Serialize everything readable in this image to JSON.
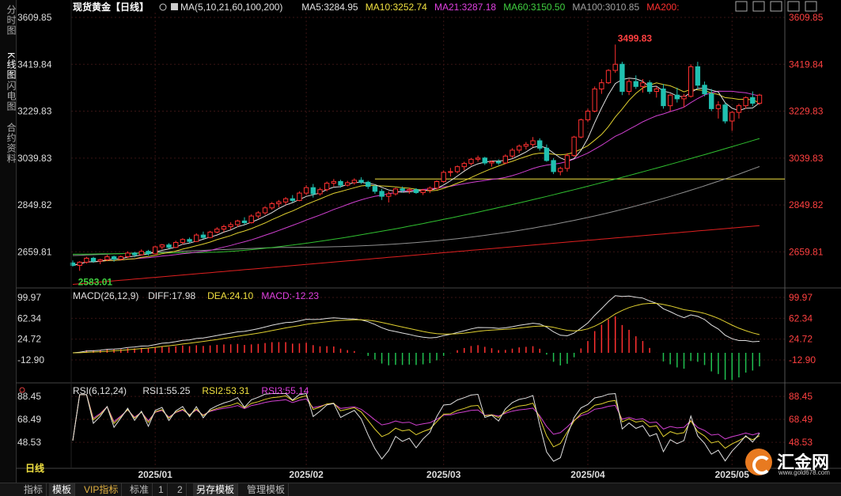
{
  "sidebar": {
    "tabs": [
      "分时图",
      "K线图",
      "闪电图",
      "合约资料"
    ]
  },
  "header": {
    "title": "现货黄金【日线】",
    "ma_items": [
      {
        "text": "MA(5,10,21,60,100,200)",
        "color": "#e0e0e0"
      },
      {
        "text": "MA5:3284.95",
        "color": "#e0e0e0"
      },
      {
        "text": "MA10:3252.74",
        "color": "#f0e040"
      },
      {
        "text": "MA21:3287.18",
        "color": "#e040e0"
      },
      {
        "text": "MA60:3150.50",
        "color": "#40d040"
      },
      {
        "text": "MA100:3010.85",
        "color": "#a0a0a0"
      },
      {
        "text": "MA200:",
        "color": "#ff3030"
      }
    ]
  },
  "toolbar_icons": [
    "add-icon",
    "minus-icon",
    "restore-icon",
    "window-icon",
    "close-icon"
  ],
  "macd_header": [
    {
      "text": "MACD(26,12,9)",
      "color": "#e0e0e0"
    },
    {
      "text": "DIFF:17.98",
      "color": "#e0e0e0"
    },
    {
      "text": "DEA:24.10",
      "color": "#f0e040"
    },
    {
      "text": "MACD:-12.23",
      "color": "#e040e0"
    }
  ],
  "rsi_header": [
    {
      "text": "RSI(6,12,24)",
      "color": "#e0e0e0"
    },
    {
      "text": "RSI1:55.25",
      "color": "#e0e0e0"
    },
    {
      "text": "RSI2:53.31",
      "color": "#f0e040"
    },
    {
      "text": "RSI3:55.14",
      "color": "#e040e0"
    }
  ],
  "bottom_bar": {
    "period": "日线",
    "tabs": [
      "指标",
      "模板",
      "VIP指标",
      "标准",
      "1",
      "2",
      "另存模板",
      "管理模板"
    ]
  },
  "watermark": {
    "name": "汇金网",
    "url": "www.gold678.com"
  },
  "chart_data": {
    "type": "candlestick",
    "price_axis_ticks": [
      "3609.85",
      "3419.84",
      "3229.83",
      "3039.83",
      "2849.82",
      "2659.81"
    ],
    "price_range": [
      2520,
      3609.85
    ],
    "macd_axis_ticks": [
      "99.97",
      "62.34",
      "24.72",
      "-12.90"
    ],
    "macd_range": [
      -40,
      100
    ],
    "rsi_axis_ticks": [
      "88.45",
      "68.49",
      "48.53"
    ],
    "rsi_range": [
      30,
      92
    ],
    "x_ticks": [
      {
        "label": "2025/01",
        "index": 12
      },
      {
        "label": "2025/02",
        "index": 34
      },
      {
        "label": "2025/03",
        "index": 54
      },
      {
        "label": "2025/04",
        "index": 75
      },
      {
        "label": "2025/05",
        "index": 96
      }
    ],
    "high_label": "3499.83",
    "low_label": "2583.01",
    "resistance_level": 2955,
    "candles": [
      [
        2615,
        2625,
        2600,
        2605
      ],
      [
        2605,
        2622,
        2583.01,
        2618
      ],
      [
        2618,
        2640,
        2612,
        2634
      ],
      [
        2634,
        2640,
        2615,
        2622
      ],
      [
        2622,
        2632,
        2610,
        2628
      ],
      [
        2628,
        2648,
        2622,
        2640
      ],
      [
        2640,
        2645,
        2620,
        2630
      ],
      [
        2630,
        2645,
        2625,
        2640
      ],
      [
        2640,
        2662,
        2635,
        2655
      ],
      [
        2655,
        2660,
        2638,
        2648
      ],
      [
        2648,
        2670,
        2645,
        2662
      ],
      [
        2662,
        2668,
        2645,
        2652
      ],
      [
        2652,
        2685,
        2650,
        2680
      ],
      [
        2680,
        2692,
        2670,
        2688
      ],
      [
        2688,
        2695,
        2672,
        2678
      ],
      [
        2678,
        2705,
        2675,
        2698
      ],
      [
        2698,
        2715,
        2690,
        2710
      ],
      [
        2710,
        2718,
        2695,
        2702
      ],
      [
        2702,
        2735,
        2700,
        2728
      ],
      [
        2728,
        2742,
        2712,
        2718
      ],
      [
        2718,
        2745,
        2715,
        2740
      ],
      [
        2740,
        2760,
        2735,
        2752
      ],
      [
        2752,
        2770,
        2740,
        2762
      ],
      [
        2762,
        2780,
        2750,
        2770
      ],
      [
        2770,
        2790,
        2760,
        2785
      ],
      [
        2785,
        2800,
        2770,
        2778
      ],
      [
        2778,
        2812,
        2775,
        2805
      ],
      [
        2805,
        2825,
        2795,
        2818
      ],
      [
        2818,
        2845,
        2810,
        2838
      ],
      [
        2838,
        2862,
        2830,
        2855
      ],
      [
        2855,
        2870,
        2840,
        2862
      ],
      [
        2862,
        2882,
        2850,
        2875
      ],
      [
        2875,
        2890,
        2860,
        2868
      ],
      [
        2868,
        2905,
        2865,
        2898
      ],
      [
        2898,
        2930,
        2890,
        2920
      ],
      [
        2920,
        2935,
        2880,
        2895
      ],
      [
        2895,
        2920,
        2888,
        2912
      ],
      [
        2912,
        2945,
        2905,
        2938
      ],
      [
        2938,
        2955,
        2925,
        2945
      ],
      [
        2945,
        2952,
        2920,
        2930
      ],
      [
        2930,
        2948,
        2925,
        2940
      ],
      [
        2940,
        2958,
        2932,
        2950
      ],
      [
        2950,
        2962,
        2935,
        2942
      ],
      [
        2942,
        2948,
        2915,
        2925
      ],
      [
        2925,
        2932,
        2895,
        2905
      ],
      [
        2905,
        2915,
        2870,
        2885
      ],
      [
        2885,
        2905,
        2860,
        2895
      ],
      [
        2895,
        2920,
        2888,
        2915
      ],
      [
        2915,
        2925,
        2900,
        2908
      ],
      [
        2908,
        2920,
        2895,
        2912
      ],
      [
        2912,
        2918,
        2895,
        2900
      ],
      [
        2900,
        2915,
        2890,
        2910
      ],
      [
        2910,
        2925,
        2898,
        2918
      ],
      [
        2918,
        2950,
        2912,
        2945
      ],
      [
        2945,
        2990,
        2940,
        2982
      ],
      [
        2982,
        3000,
        2965,
        2985
      ],
      [
        2985,
        3010,
        2978,
        3005
      ],
      [
        3005,
        3025,
        2990,
        3018
      ],
      [
        3018,
        3040,
        3010,
        3035
      ],
      [
        3035,
        3050,
        3025,
        3040
      ],
      [
        3040,
        3045,
        3012,
        3020
      ],
      [
        3020,
        3030,
        3005,
        3025
      ],
      [
        3025,
        3035,
        3012,
        3020
      ],
      [
        3020,
        3055,
        3015,
        3048
      ],
      [
        3048,
        3080,
        3040,
        3072
      ],
      [
        3072,
        3095,
        3060,
        3088
      ],
      [
        3088,
        3105,
        3075,
        3095
      ],
      [
        3095,
        3125,
        3085,
        3110
      ],
      [
        3110,
        3120,
        3070,
        3080
      ],
      [
        3080,
        3095,
        3025,
        3030
      ],
      [
        3030,
        3040,
        2975,
        2985
      ],
      [
        2985,
        3005,
        2970,
        2998
      ],
      [
        2998,
        3060,
        2985,
        3050
      ],
      [
        3050,
        3130,
        3045,
        3125
      ],
      [
        3125,
        3200,
        3120,
        3195
      ],
      [
        3195,
        3240,
        3185,
        3230
      ],
      [
        3230,
        3330,
        3225,
        3320
      ],
      [
        3320,
        3360,
        3300,
        3345
      ],
      [
        3345,
        3400,
        3340,
        3395
      ],
      [
        3395,
        3499.83,
        3385,
        3420
      ],
      [
        3420,
        3430,
        3295,
        3310
      ],
      [
        3310,
        3360,
        3295,
        3350
      ],
      [
        3350,
        3375,
        3320,
        3330
      ],
      [
        3330,
        3360,
        3305,
        3345
      ],
      [
        3345,
        3355,
        3300,
        3310
      ],
      [
        3310,
        3330,
        3285,
        3320
      ],
      [
        3320,
        3340,
        3240,
        3252
      ],
      [
        3252,
        3300,
        3230,
        3295
      ],
      [
        3295,
        3325,
        3265,
        3280
      ],
      [
        3280,
        3300,
        3245,
        3290
      ],
      [
        3290,
        3420,
        3285,
        3410
      ],
      [
        3410,
        3430,
        3320,
        3335
      ],
      [
        3335,
        3350,
        3290,
        3300
      ],
      [
        3300,
        3320,
        3230,
        3240
      ],
      [
        3240,
        3270,
        3200,
        3255
      ],
      [
        3255,
        3265,
        3180,
        3190
      ],
      [
        3190,
        3230,
        3150,
        3225
      ],
      [
        3225,
        3260,
        3200,
        3252
      ],
      [
        3252,
        3290,
        3240,
        3285
      ],
      [
        3285,
        3310,
        3250,
        3262
      ],
      [
        3262,
        3300,
        3255,
        3295
      ]
    ]
  }
}
